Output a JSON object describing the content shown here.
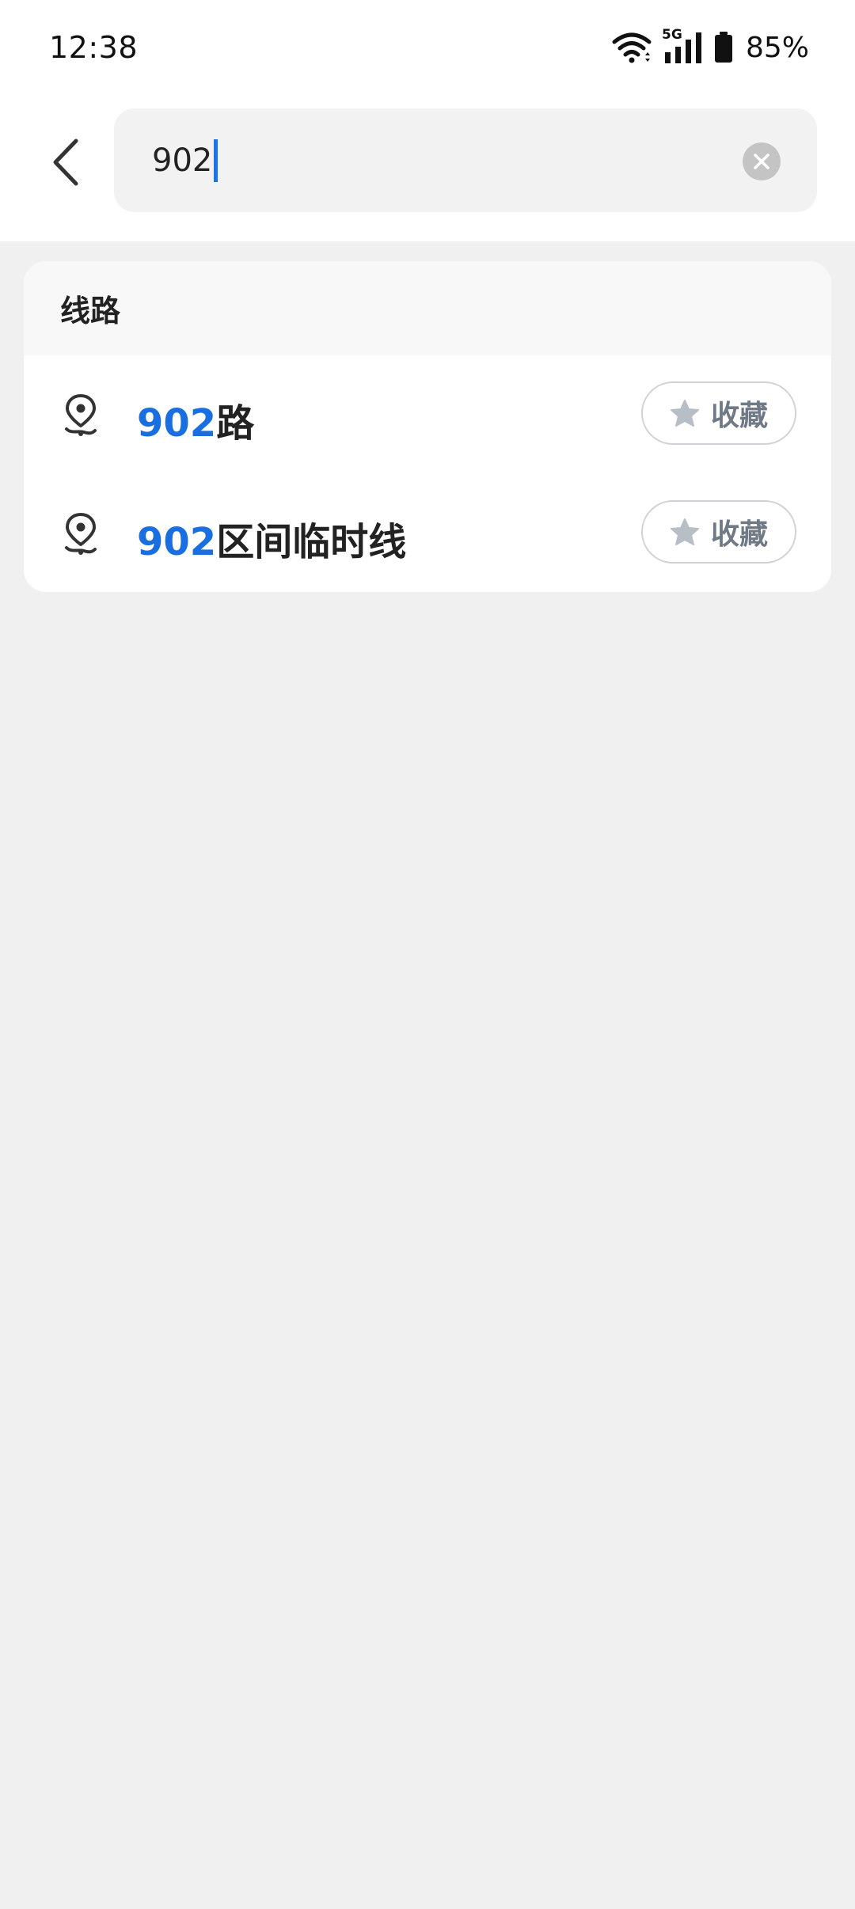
{
  "status_bar": {
    "time": "12:38",
    "network": "5G",
    "battery_percent": "85%"
  },
  "search": {
    "query": "902",
    "back_icon": "chevron-left-icon",
    "clear_icon": "clear-circle-icon"
  },
  "results": {
    "section_title": "线路",
    "items": [
      {
        "highlight": "902",
        "rest": "路",
        "favorite_label": "收藏",
        "icon": "route-pin-icon"
      },
      {
        "highlight": "902",
        "rest": "区间临时线",
        "favorite_label": "收藏",
        "icon": "route-pin-icon"
      }
    ]
  },
  "colors": {
    "highlight": "#1a6fe0",
    "caret": "#1a73e8",
    "page_bg": "#f0f0f0"
  }
}
